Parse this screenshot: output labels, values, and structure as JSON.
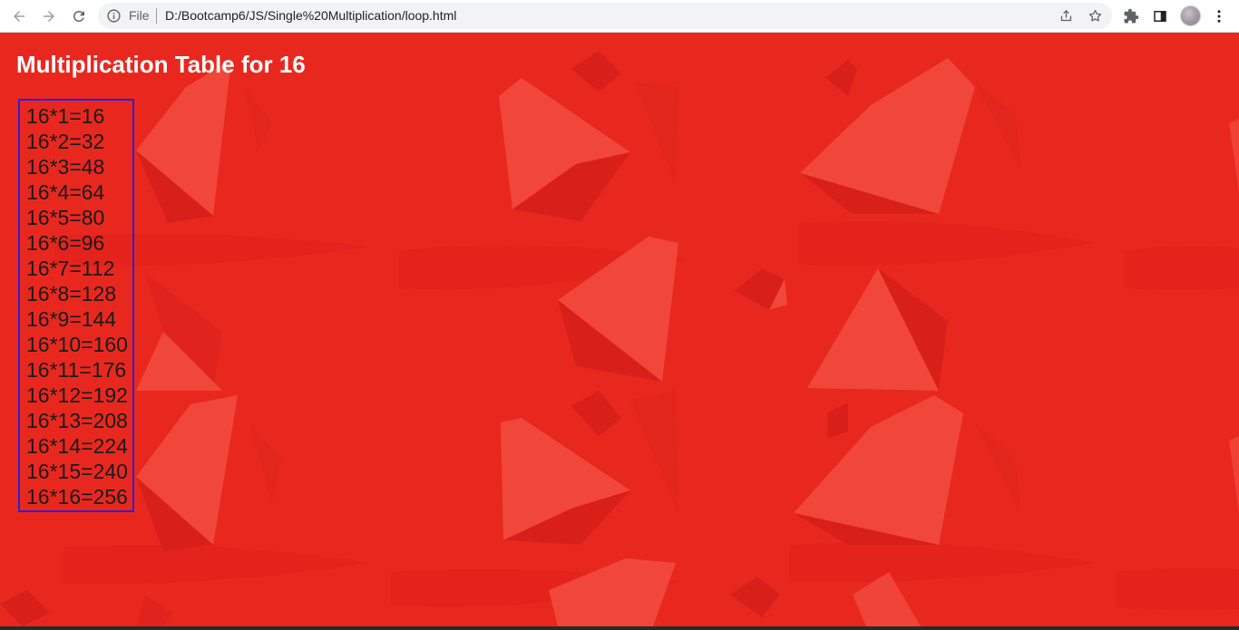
{
  "browser": {
    "scheme_label": "File",
    "url": "D:/Bootcamp6/JS/Single%20Multiplication/loop.html",
    "icons": {
      "back": "arrow-left-icon",
      "forward": "arrow-right-icon",
      "reload": "reload-icon",
      "info": "info-icon",
      "share": "share-icon",
      "bookmark": "star-icon",
      "extensions": "puzzle-icon",
      "side_panel": "side-panel-icon",
      "profile": "avatar",
      "menu": "kebab-menu-icon"
    }
  },
  "page": {
    "title": "Multiplication Table for 16",
    "background_color": "#e8281f",
    "table_border_color": "#2f1fd0",
    "lines": [
      "16*1=16",
      "16*2=32",
      "16*3=48",
      "16*4=64",
      "16*5=80",
      "16*6=96",
      "16*7=112",
      "16*8=128",
      "16*9=144",
      "16*10=160",
      "16*11=176",
      "16*12=192",
      "16*13=208",
      "16*14=224",
      "16*15=240",
      "16*16=256"
    ]
  }
}
